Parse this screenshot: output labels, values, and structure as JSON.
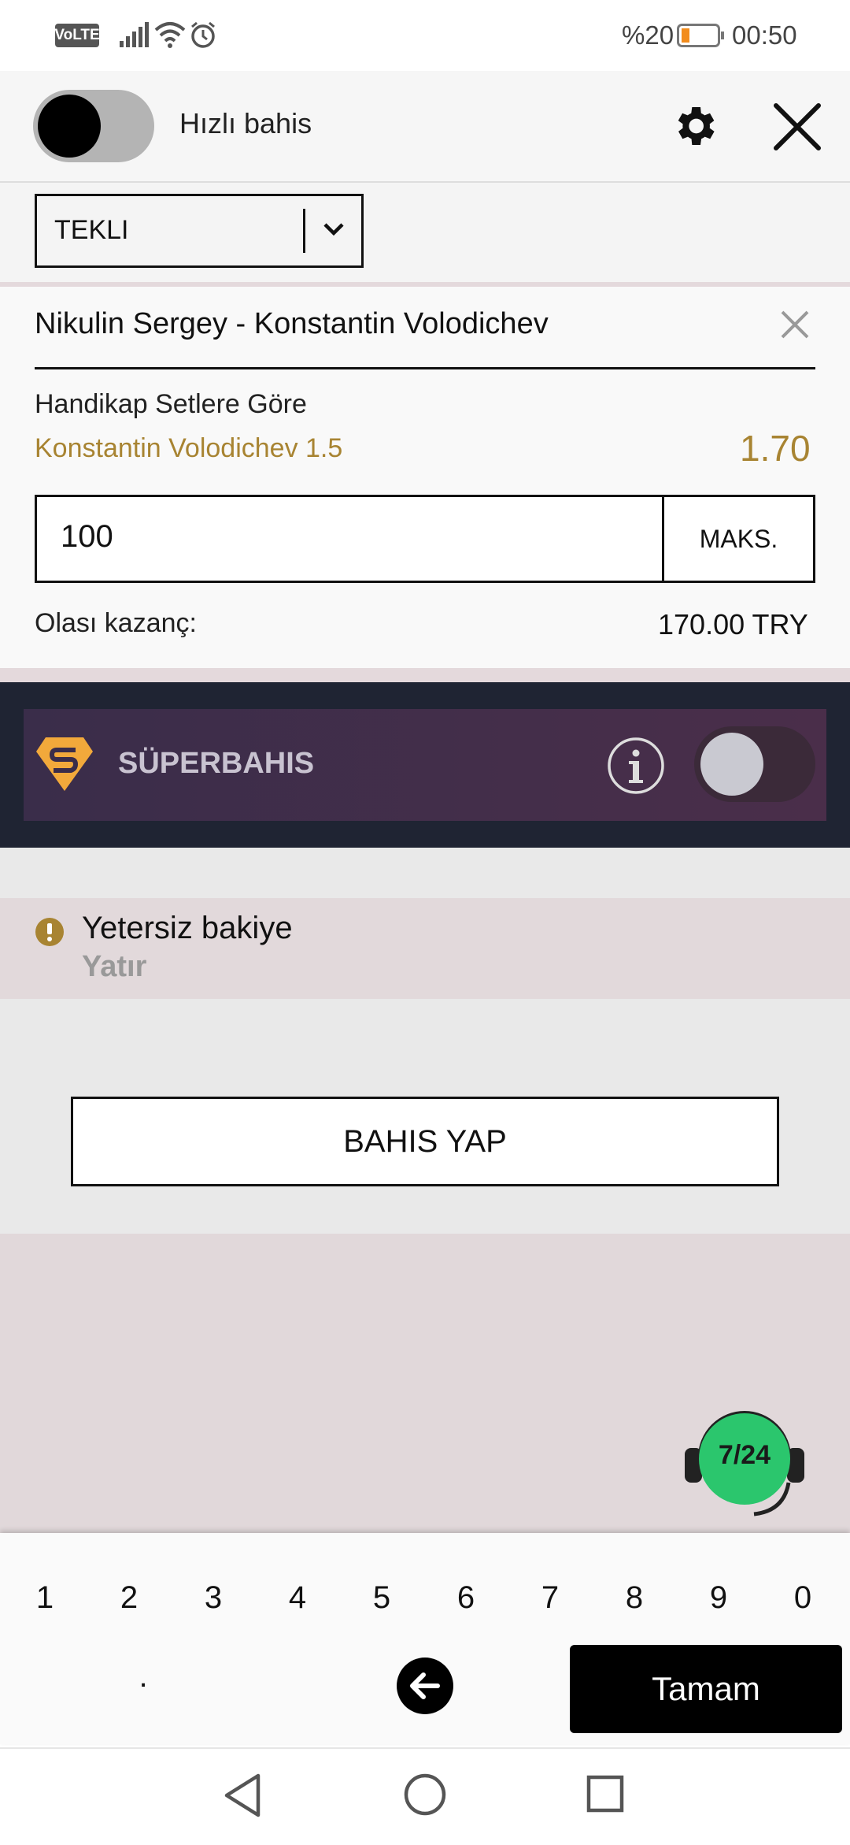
{
  "status_bar": {
    "volte": "VoLTE",
    "battery": "%20",
    "time": "00:50"
  },
  "header": {
    "quick_bet_label": "Hızlı bahis"
  },
  "bet_type": {
    "selected": "TEKLI"
  },
  "bet": {
    "match": "Nikulin Sergey - Konstantin Volodichev",
    "market": "Handikap Setlere Göre",
    "selection": "Konstantin Volodichev 1.5",
    "odds": "1.70",
    "stake": "100",
    "max_label": "MAKS.",
    "potential_label": "Olası kazanç:",
    "potential_value": "170.00 TRY"
  },
  "super": {
    "label": "SÜPERBAHIS",
    "toggle_on": false
  },
  "warning": {
    "title": "Yetersiz bakiye",
    "action": "Yatır"
  },
  "place_bet_label": "BAHIS YAP",
  "support_badge": "7/24",
  "keyboard": {
    "digits": [
      "1",
      "2",
      "3",
      "4",
      "5",
      "6",
      "7",
      "8",
      "9",
      "0"
    ],
    "dot": ".",
    "done_label": "Tamam"
  },
  "colors": {
    "accent_gold": "#a88432",
    "support_green": "#2bc66d",
    "super_logo": "#f2a93b"
  }
}
